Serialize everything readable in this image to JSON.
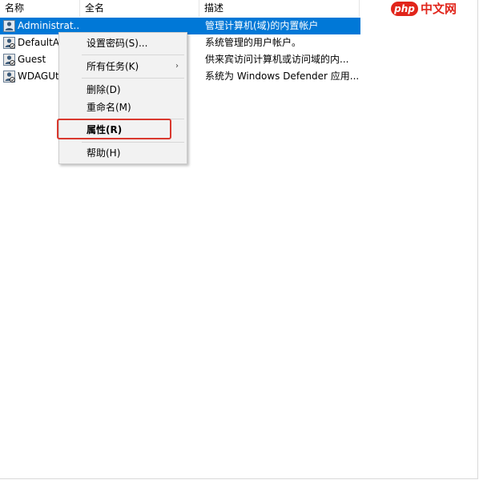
{
  "columns": [
    "名称",
    "全名",
    "描述"
  ],
  "users": [
    {
      "name": "Administrat...",
      "desc": "管理计算机(域)的内置帐户",
      "selected": true
    },
    {
      "name": "DefaultAc",
      "desc": "系统管理的用户帐户。",
      "selected": false
    },
    {
      "name": "Guest",
      "desc": "供来宾访问计算机或访问域的内...",
      "selected": false
    },
    {
      "name": "WDAGUt",
      "desc": "系统为 Windows Defender 应用...",
      "selected": false
    }
  ],
  "context_menu": {
    "items": [
      {
        "label": "设置密码(S)...",
        "submenu": false
      },
      {
        "label": "所有任务(K)",
        "submenu": true
      },
      {
        "label": "删除(D)",
        "submenu": false
      },
      {
        "label": "重命名(M)",
        "submenu": false
      },
      {
        "label": "属性(R)",
        "submenu": false,
        "bold": true,
        "highlighted": true
      },
      {
        "label": "帮助(H)",
        "submenu": false
      }
    ],
    "submenu_arrow": "›"
  },
  "watermark": {
    "badge": "php",
    "text": "中文网"
  },
  "colors": {
    "selection": "#0078d7",
    "highlight_box": "#d9382e",
    "watermark": "#e1251b"
  },
  "icons": {
    "user": "user-account-icon"
  }
}
